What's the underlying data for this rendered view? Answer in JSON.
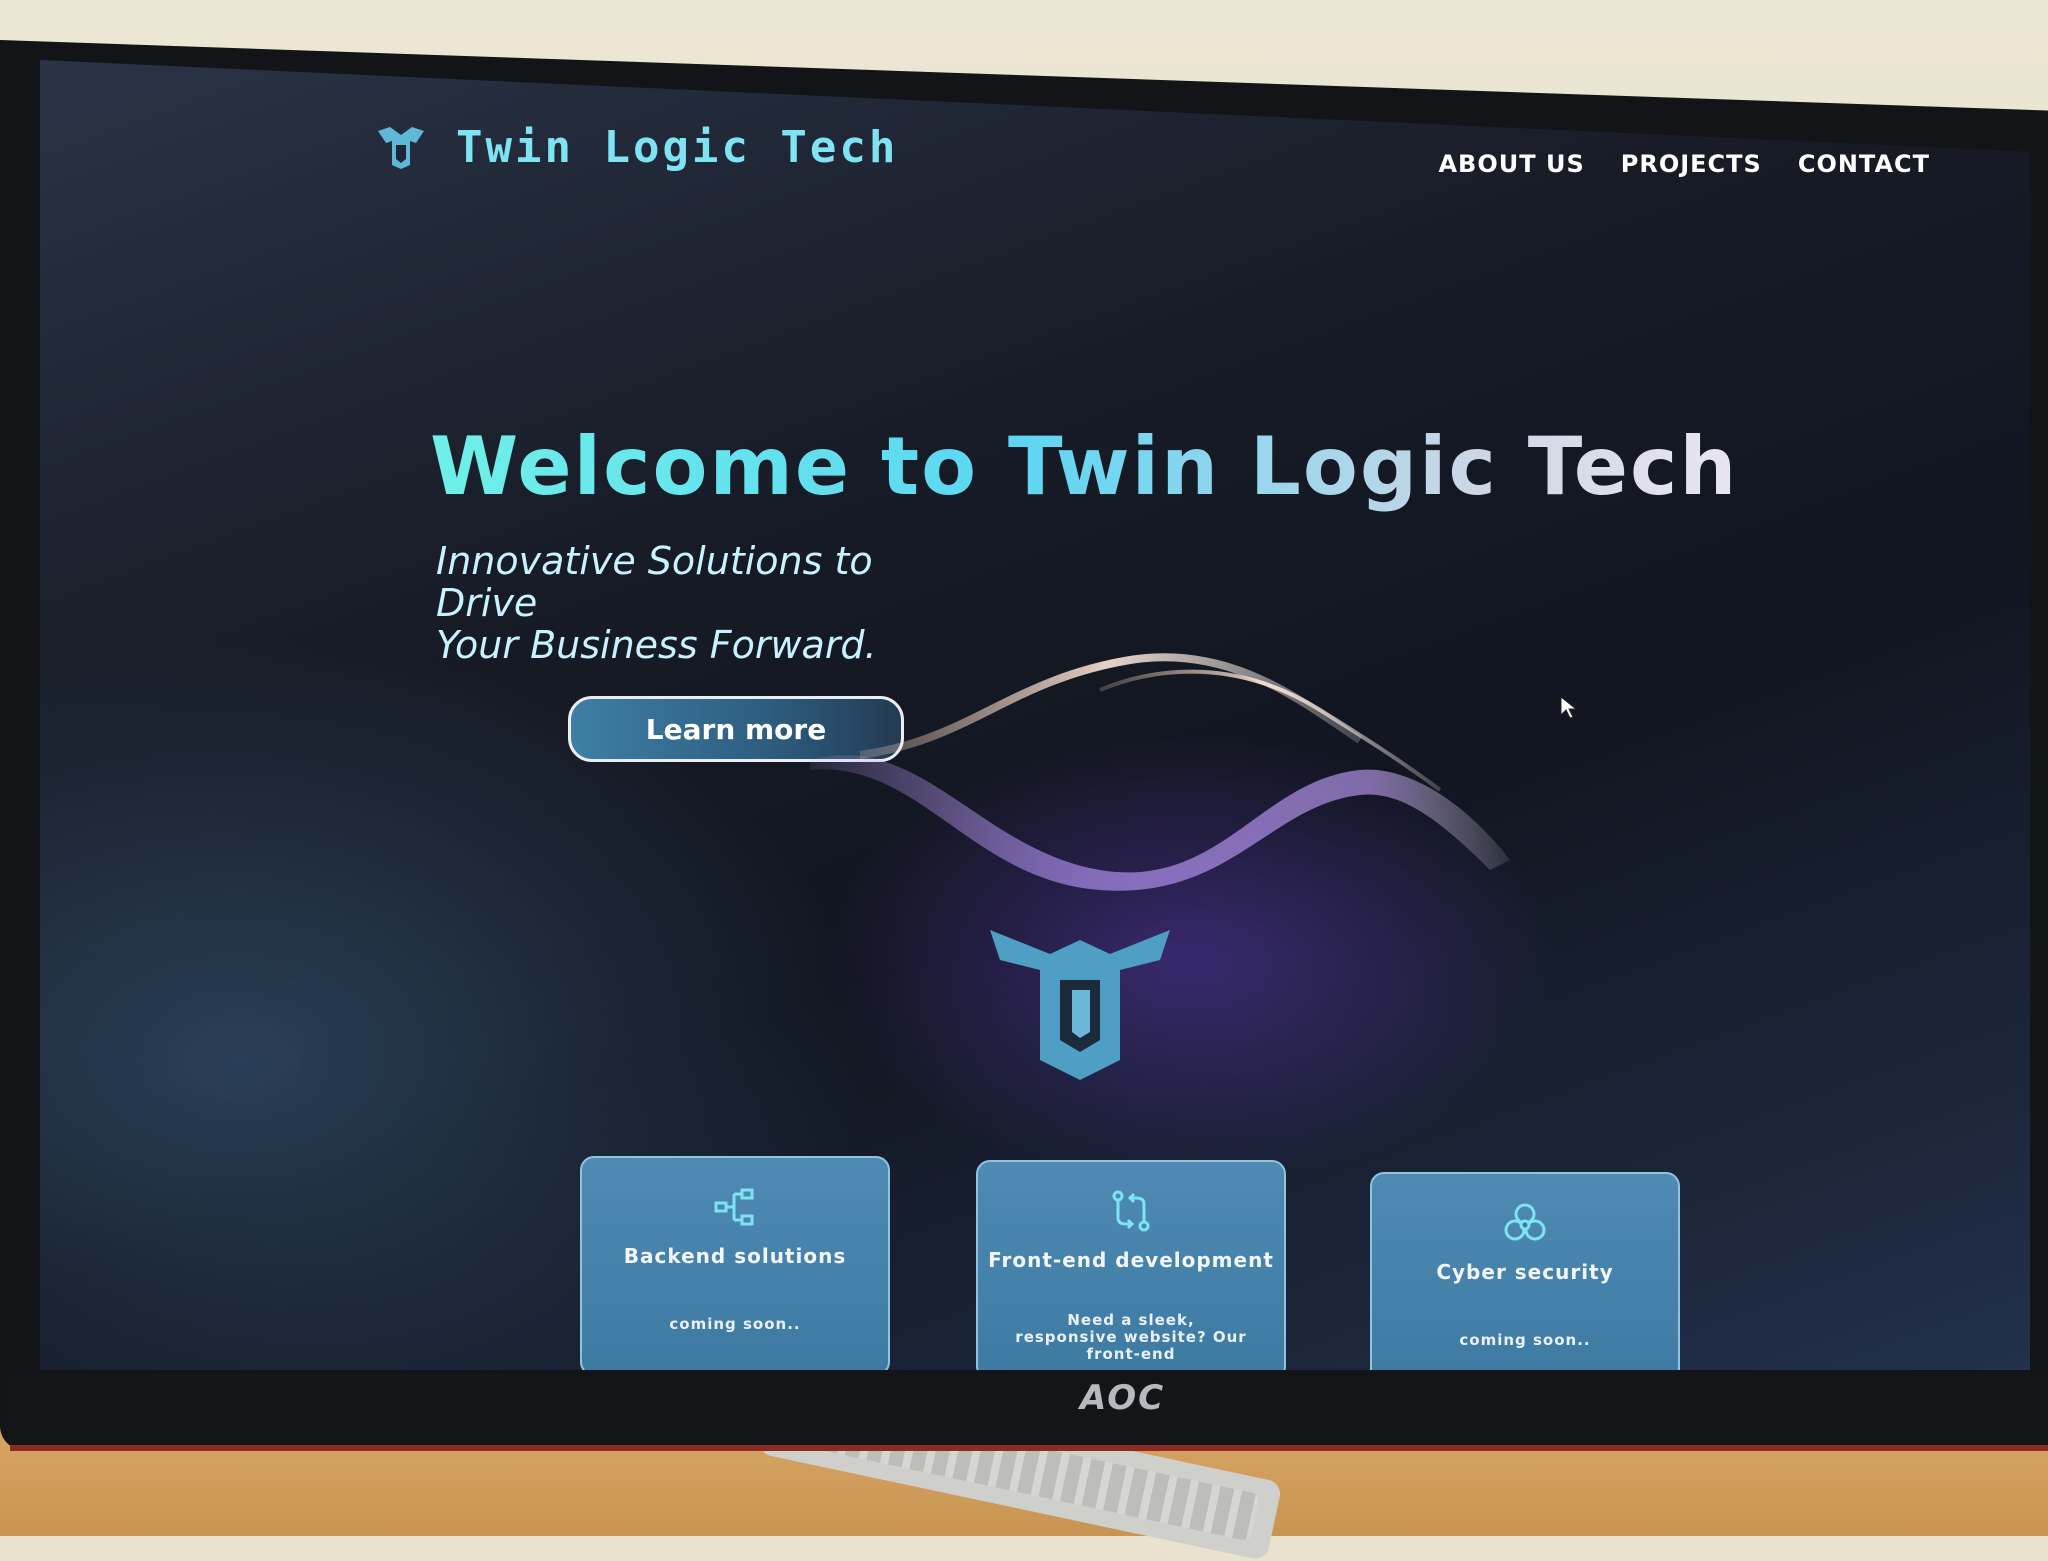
{
  "site": {
    "title": "Twin Logic Tech"
  },
  "nav": {
    "items": [
      "ABOUT US",
      "PROJECTS",
      "CONTACT"
    ]
  },
  "hero": {
    "title": "Welcome to Twin Logic Tech",
    "subtitle_line1": "Innovative Solutions to Drive",
    "subtitle_line2": "Your Business Forward.",
    "cta_label": "Learn more"
  },
  "services": [
    {
      "title": "Backend solutions",
      "text": "coming soon..",
      "icon": "hierarchy-icon"
    },
    {
      "title": "Front-end development",
      "text": "Need a sleek, responsive website? Our front-end",
      "icon": "git-compare-icon"
    },
    {
      "title": "Cyber security",
      "text": "coming soon..",
      "icon": "biohazard-icon"
    }
  ],
  "monitor": {
    "brand": "AOC"
  },
  "colors": {
    "accent": "#6ef0e8",
    "card": "#4e8ab3",
    "background": "#171b26"
  }
}
